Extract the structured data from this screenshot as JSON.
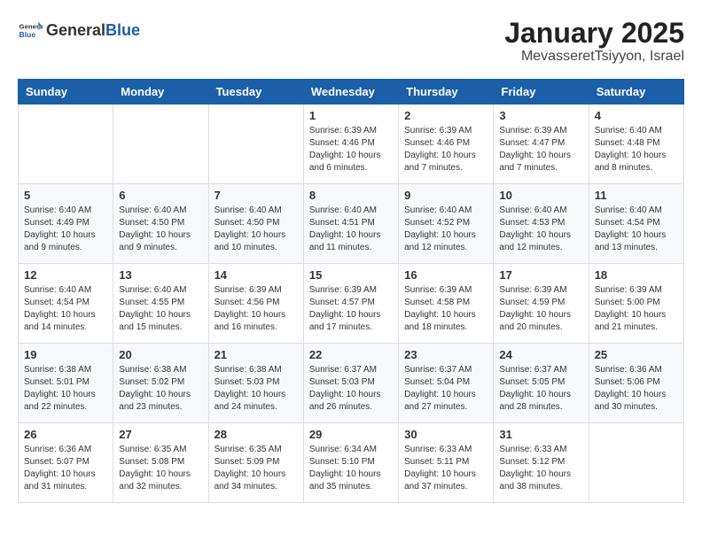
{
  "header": {
    "logo_general": "General",
    "logo_blue": "Blue",
    "month": "January 2025",
    "location": "MevasseretTsiyyon, Israel"
  },
  "weekdays": [
    "Sunday",
    "Monday",
    "Tuesday",
    "Wednesday",
    "Thursday",
    "Friday",
    "Saturday"
  ],
  "weeks": [
    [
      null,
      null,
      null,
      {
        "day": "1",
        "sunrise": "6:39 AM",
        "sunset": "4:46 PM",
        "daylight": "10 hours and 6 minutes."
      },
      {
        "day": "2",
        "sunrise": "6:39 AM",
        "sunset": "4:46 PM",
        "daylight": "10 hours and 7 minutes."
      },
      {
        "day": "3",
        "sunrise": "6:39 AM",
        "sunset": "4:47 PM",
        "daylight": "10 hours and 7 minutes."
      },
      {
        "day": "4",
        "sunrise": "6:40 AM",
        "sunset": "4:48 PM",
        "daylight": "10 hours and 8 minutes."
      }
    ],
    [
      {
        "day": "5",
        "sunrise": "6:40 AM",
        "sunset": "4:49 PM",
        "daylight": "10 hours and 9 minutes."
      },
      {
        "day": "6",
        "sunrise": "6:40 AM",
        "sunset": "4:50 PM",
        "daylight": "10 hours and 9 minutes."
      },
      {
        "day": "7",
        "sunrise": "6:40 AM",
        "sunset": "4:50 PM",
        "daylight": "10 hours and 10 minutes."
      },
      {
        "day": "8",
        "sunrise": "6:40 AM",
        "sunset": "4:51 PM",
        "daylight": "10 hours and 11 minutes."
      },
      {
        "day": "9",
        "sunrise": "6:40 AM",
        "sunset": "4:52 PM",
        "daylight": "10 hours and 12 minutes."
      },
      {
        "day": "10",
        "sunrise": "6:40 AM",
        "sunset": "4:53 PM",
        "daylight": "10 hours and 12 minutes."
      },
      {
        "day": "11",
        "sunrise": "6:40 AM",
        "sunset": "4:54 PM",
        "daylight": "10 hours and 13 minutes."
      }
    ],
    [
      {
        "day": "12",
        "sunrise": "6:40 AM",
        "sunset": "4:54 PM",
        "daylight": "10 hours and 14 minutes."
      },
      {
        "day": "13",
        "sunrise": "6:40 AM",
        "sunset": "4:55 PM",
        "daylight": "10 hours and 15 minutes."
      },
      {
        "day": "14",
        "sunrise": "6:39 AM",
        "sunset": "4:56 PM",
        "daylight": "10 hours and 16 minutes."
      },
      {
        "day": "15",
        "sunrise": "6:39 AM",
        "sunset": "4:57 PM",
        "daylight": "10 hours and 17 minutes."
      },
      {
        "day": "16",
        "sunrise": "6:39 AM",
        "sunset": "4:58 PM",
        "daylight": "10 hours and 18 minutes."
      },
      {
        "day": "17",
        "sunrise": "6:39 AM",
        "sunset": "4:59 PM",
        "daylight": "10 hours and 20 minutes."
      },
      {
        "day": "18",
        "sunrise": "6:39 AM",
        "sunset": "5:00 PM",
        "daylight": "10 hours and 21 minutes."
      }
    ],
    [
      {
        "day": "19",
        "sunrise": "6:38 AM",
        "sunset": "5:01 PM",
        "daylight": "10 hours and 22 minutes."
      },
      {
        "day": "20",
        "sunrise": "6:38 AM",
        "sunset": "5:02 PM",
        "daylight": "10 hours and 23 minutes."
      },
      {
        "day": "21",
        "sunrise": "6:38 AM",
        "sunset": "5:03 PM",
        "daylight": "10 hours and 24 minutes."
      },
      {
        "day": "22",
        "sunrise": "6:37 AM",
        "sunset": "5:03 PM",
        "daylight": "10 hours and 26 minutes."
      },
      {
        "day": "23",
        "sunrise": "6:37 AM",
        "sunset": "5:04 PM",
        "daylight": "10 hours and 27 minutes."
      },
      {
        "day": "24",
        "sunrise": "6:37 AM",
        "sunset": "5:05 PM",
        "daylight": "10 hours and 28 minutes."
      },
      {
        "day": "25",
        "sunrise": "6:36 AM",
        "sunset": "5:06 PM",
        "daylight": "10 hours and 30 minutes."
      }
    ],
    [
      {
        "day": "26",
        "sunrise": "6:36 AM",
        "sunset": "5:07 PM",
        "daylight": "10 hours and 31 minutes."
      },
      {
        "day": "27",
        "sunrise": "6:35 AM",
        "sunset": "5:08 PM",
        "daylight": "10 hours and 32 minutes."
      },
      {
        "day": "28",
        "sunrise": "6:35 AM",
        "sunset": "5:09 PM",
        "daylight": "10 hours and 34 minutes."
      },
      {
        "day": "29",
        "sunrise": "6:34 AM",
        "sunset": "5:10 PM",
        "daylight": "10 hours and 35 minutes."
      },
      {
        "day": "30",
        "sunrise": "6:33 AM",
        "sunset": "5:11 PM",
        "daylight": "10 hours and 37 minutes."
      },
      {
        "day": "31",
        "sunrise": "6:33 AM",
        "sunset": "5:12 PM",
        "daylight": "10 hours and 38 minutes."
      },
      null
    ]
  ]
}
